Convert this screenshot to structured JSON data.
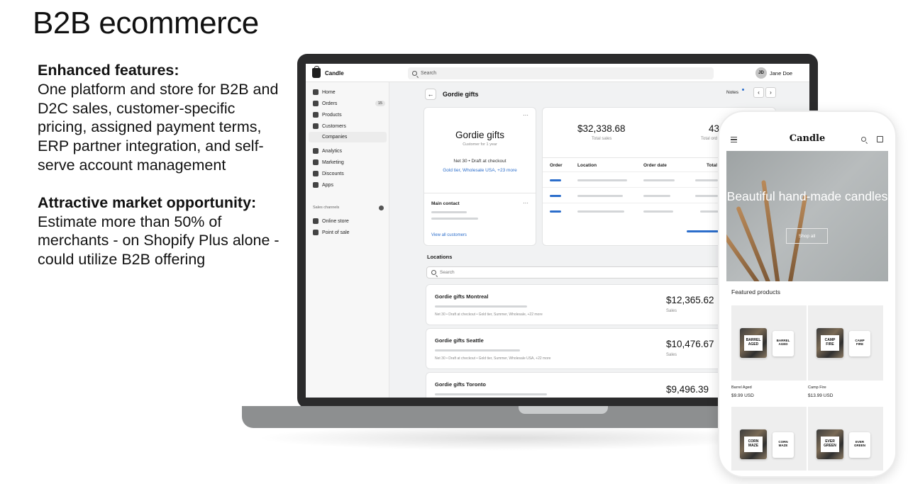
{
  "slide": {
    "title": "B2B ecommerce",
    "section1_heading": "Enhanced features:",
    "section1_body": "One platform and store for B2B and D2C sales, customer-specific pricing, assigned payment terms, ERP partner integration, and self-serve account management",
    "section2_heading": "Attractive market opportunity:",
    "section2_body": "Estimate more than 50% of merchants - on Shopify Plus alone - could utilize B2B offering"
  },
  "admin": {
    "brand": "Candle",
    "search_placeholder": "Search",
    "user": {
      "initials": "JD",
      "name": "Jane Doe"
    },
    "nav": [
      {
        "label": "Home",
        "icon": "home-icon"
      },
      {
        "label": "Orders",
        "icon": "orders-icon",
        "badge": "15"
      },
      {
        "label": "Products",
        "icon": "tag-icon"
      },
      {
        "label": "Customers",
        "icon": "person-icon"
      }
    ],
    "nav_sub": "Companies",
    "nav2": [
      {
        "label": "Analytics",
        "icon": "chart-icon"
      },
      {
        "label": "Marketing",
        "icon": "target-icon"
      },
      {
        "label": "Discounts",
        "icon": "discount-icon"
      },
      {
        "label": "Apps",
        "icon": "apps-icon"
      }
    ],
    "sales_channels_label": "Sales channels",
    "channels": [
      {
        "label": "Online store",
        "icon": "store-icon"
      },
      {
        "label": "Point of sale",
        "icon": "pos-icon"
      }
    ],
    "page_title": "Gordie gifts",
    "back": "←",
    "notes": "Notes",
    "prev": "‹",
    "next": "›",
    "company": {
      "menu": "···",
      "name": "Gordie gifts",
      "subtitle": "Customer for 1 year",
      "terms": "Net 30 • Draft at checkout",
      "tags": "Gold tier, Wholesale USA, +23 more",
      "main_contact": "Main contact",
      "contact_menu": "···",
      "view_all": "View all customers"
    },
    "stats": {
      "total_sales_value": "$32,338.68",
      "total_sales_label": "Total sales",
      "orders_value": "43",
      "orders_label": "Total ord",
      "columns": [
        "Order",
        "Location",
        "Order date",
        "Total"
      ]
    },
    "locations_title": "Locations",
    "locations_search_placeholder": "Search",
    "locations": [
      {
        "name": "Gordie gifts Montreal",
        "value": "$12,365.62",
        "sales_label": "Sales",
        "meta": "Net 30 • Draft at checkout • Gold tier, Summer, Wholesale, +22 more"
      },
      {
        "name": "Gordie gifts Seattle",
        "value": "$10,476.67",
        "sales_label": "Sales",
        "meta": "Net 30 • Draft at checkout • Gold tier, Summer, Wholesale USA, +22 more"
      },
      {
        "name": "Gordie gifts Toronto",
        "value": "$9,496.39",
        "sales_label": "",
        "meta": ""
      }
    ]
  },
  "store": {
    "logo": "Candle",
    "hero_title": "Beautiful hand-made candles",
    "hero_button": "Shop all",
    "featured_label": "Featured products",
    "products": [
      {
        "name": "Barrel Aged",
        "price": "$9.99 USD",
        "label": "BARREL AGED"
      },
      {
        "name": "Camp Fire",
        "price": "$13.99 USD",
        "label": "CAMP FIRE"
      },
      {
        "name": "",
        "price": "",
        "label": "CORN MAZE"
      },
      {
        "name": "",
        "price": "",
        "label": "EVER GREEN"
      }
    ]
  }
}
